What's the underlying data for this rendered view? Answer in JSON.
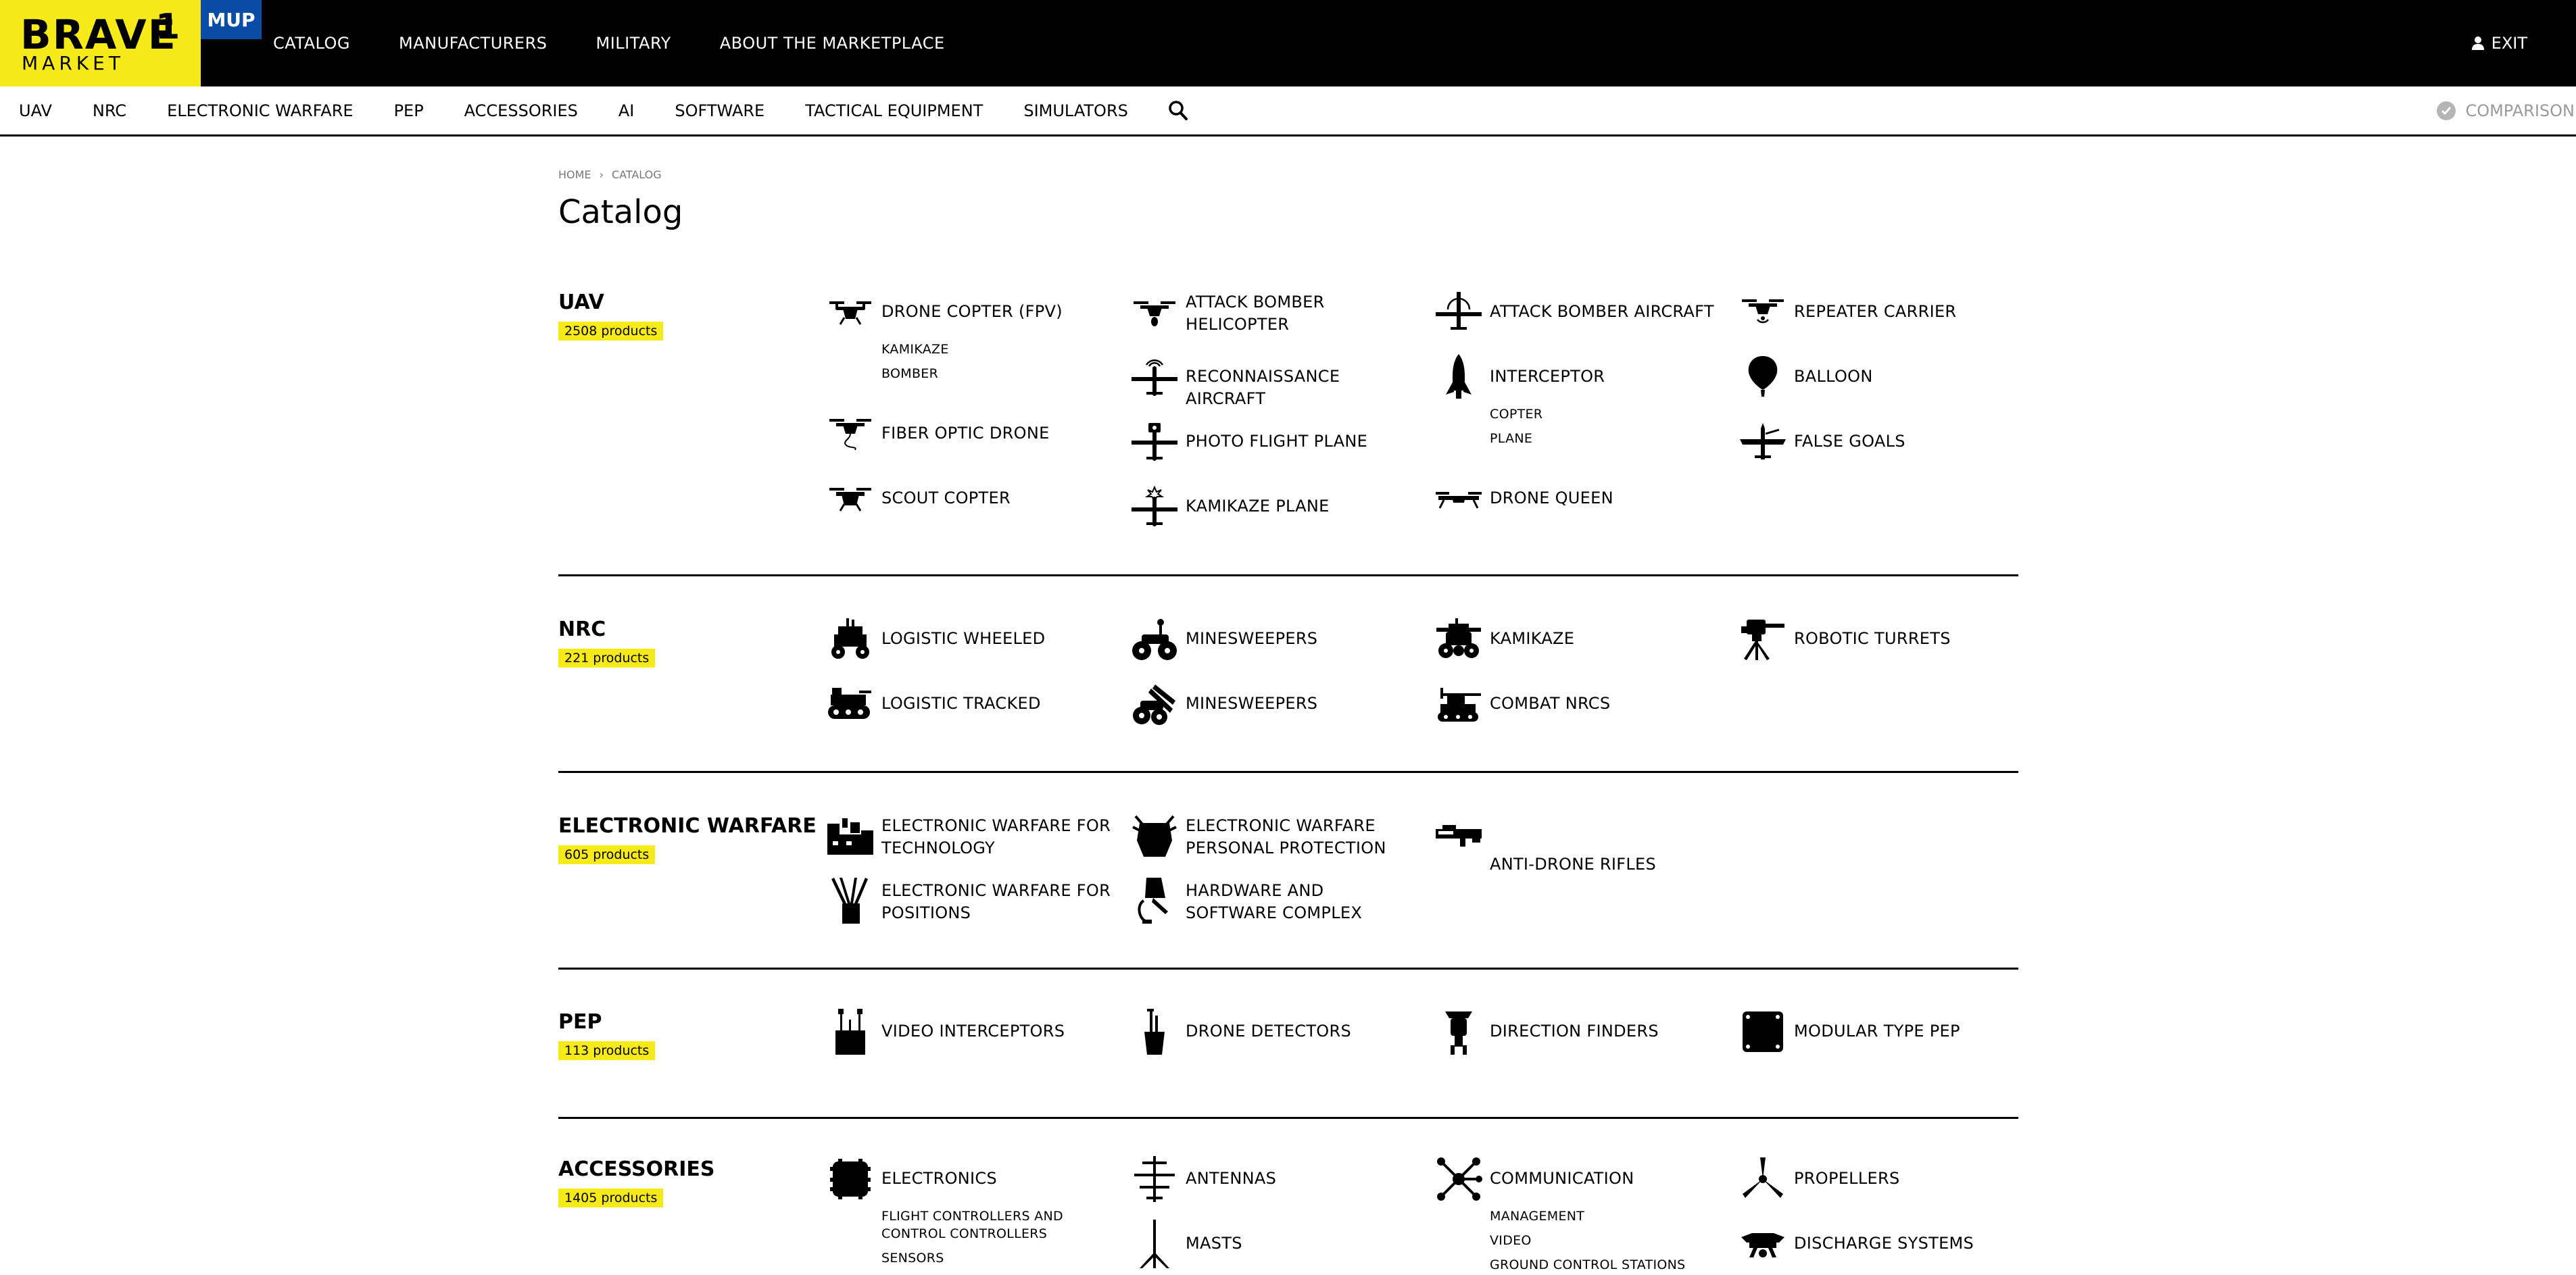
{
  "header": {
    "logo_main": "BRAVE",
    "logo_number": "1",
    "logo_sub": "MARKET",
    "badge": "MUP",
    "nav": [
      "CATALOG",
      "MANUFACTURERS",
      "MILITARY",
      "ABOUT THE MARKETPLACE"
    ],
    "exit": "EXIT"
  },
  "subnav": {
    "items": [
      "UAV",
      "NRC",
      "ELECTRONIC WARFARE",
      "PEP",
      "ACCESSORIES",
      "AI",
      "SOFTWARE",
      "TACTICAL EQUIPMENT",
      "SIMULATORS"
    ],
    "comparison": "COMPARISON"
  },
  "breadcrumb": [
    "HOME",
    "CATALOG"
  ],
  "page_title": "Catalog",
  "sections": [
    {
      "title": "UAV",
      "count": "2508 products",
      "categories": [
        {
          "label": "DRONE COPTER (FPV)",
          "icon": "quadcopter-icon",
          "subs": [
            "KAMIKAZE",
            "BOMBER"
          ]
        },
        {
          "label": "FIBER OPTIC DRONE",
          "icon": "fiber-drone-icon",
          "subs": []
        },
        {
          "label": "SCOUT COPTER",
          "icon": "quadcopter-icon",
          "subs": []
        },
        {
          "label": "ATTACK BOMBER HELICOPTER",
          "icon": "bomber-copter-icon",
          "subs": []
        },
        {
          "label": "RECONNAISSANCE AIRCRAFT",
          "icon": "plane-icon",
          "subs": []
        },
        {
          "label": "PHOTO FLIGHT PLANE",
          "icon": "plane-icon",
          "subs": []
        },
        {
          "label": "KAMIKAZE PLANE",
          "icon": "plane-icon",
          "subs": []
        },
        {
          "label": "ATTACK BOMBER AIRCRAFT",
          "icon": "plane-icon",
          "subs": []
        },
        {
          "label": "INTERCEPTOR",
          "icon": "rocket-icon",
          "subs": [
            "COPTER",
            "PLANE"
          ]
        },
        {
          "label": "DRONE QUEEN",
          "icon": "quadcopter-icon",
          "subs": []
        },
        {
          "label": "REPEATER CARRIER",
          "icon": "quadcopter-icon",
          "subs": []
        },
        {
          "label": "BALLOON",
          "icon": "balloon-icon",
          "subs": []
        },
        {
          "label": "FALSE GOALS",
          "icon": "plane-icon",
          "subs": []
        }
      ]
    },
    {
      "title": "NRC",
      "count": "221 products",
      "categories": [
        {
          "label": "LOGISTIC WHEELED",
          "icon": "wheeled-robot-icon",
          "subs": []
        },
        {
          "label": "LOGISTIC TRACKED",
          "icon": "tracked-robot-icon",
          "subs": []
        },
        {
          "label": "MINESWEEPERS",
          "icon": "minesweeper-icon",
          "subs": []
        },
        {
          "label": "MINESWEEPERS",
          "icon": "minesweeper-icon",
          "subs": []
        },
        {
          "label": "KAMIKAZE",
          "icon": "kamikaze-robot-icon",
          "subs": []
        },
        {
          "label": "COMBAT NRCS",
          "icon": "combat-robot-icon",
          "subs": []
        },
        {
          "label": "ROBOTIC TURRETS",
          "icon": "turret-icon",
          "subs": []
        }
      ]
    },
    {
      "title": "ELECTRONIC WARFARE",
      "count": "605 products",
      "categories": [
        {
          "label": "ELECTRONIC WARFARE FOR TECHNOLOGY",
          "icon": "ew-vehicle-icon",
          "subs": []
        },
        {
          "label": "ELECTRONIC WARFARE FOR POSITIONS",
          "icon": "ew-antenna-icon",
          "subs": []
        },
        {
          "label": "ELECTRONIC WARFARE PERSONAL PROTECTION",
          "icon": "ew-personal-icon",
          "subs": []
        },
        {
          "label": "HARDWARE AND SOFTWARE COMPLEX",
          "icon": "hardware-icon",
          "subs": []
        },
        {
          "label": "ANTI-DRONE RIFLES",
          "icon": "rifle-icon",
          "subs": []
        }
      ]
    },
    {
      "title": "PEP",
      "count": "113 products",
      "categories": [
        {
          "label": "VIDEO INTERCEPTORS",
          "icon": "video-interceptor-icon",
          "subs": []
        },
        {
          "label": "DRONE DETECTORS",
          "icon": "detector-icon",
          "subs": []
        },
        {
          "label": "DIRECTION FINDERS",
          "icon": "direction-finder-icon",
          "subs": []
        },
        {
          "label": "MODULAR TYPE PEP",
          "icon": "module-icon",
          "subs": []
        }
      ]
    },
    {
      "title": "ACCESSORIES",
      "count": "1405 products",
      "categories": [
        {
          "label": "ELECTRONICS",
          "icon": "chip-icon",
          "subs": [
            "FLIGHT CONTROLLERS AND CONTROL CONTROLLERS",
            "SENSORS"
          ]
        },
        {
          "label": "ANTENNAS",
          "icon": "antenna-icon",
          "subs": []
        },
        {
          "label": "MASTS",
          "icon": "mast-icon",
          "subs": []
        },
        {
          "label": "COMMUNICATION",
          "icon": "network-icon",
          "subs": [
            "MANAGEMENT",
            "VIDEO",
            "GROUND CONTROL STATIONS"
          ]
        },
        {
          "label": "PROPELLERS",
          "icon": "propeller-icon",
          "subs": []
        },
        {
          "label": "DISCHARGE SYSTEMS",
          "icon": "discharge-icon",
          "subs": []
        }
      ]
    }
  ]
}
